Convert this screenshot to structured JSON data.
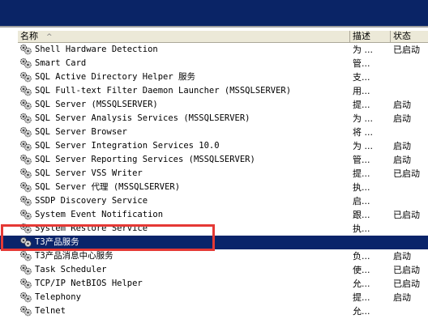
{
  "header": {
    "name": "名称",
    "description": "描述",
    "status": "状态"
  },
  "services": [
    {
      "name": "Shell Hardware Detection",
      "description": "为 ...",
      "status": "已启动"
    },
    {
      "name": "Smart Card",
      "description": "管...",
      "status": ""
    },
    {
      "name": "SQL Active Directory Helper 服务",
      "description": "支...",
      "status": ""
    },
    {
      "name": "SQL Full-text Filter Daemon Launcher (MSSQLSERVER)",
      "description": "用...",
      "status": ""
    },
    {
      "name": "SQL Server (MSSQLSERVER)",
      "description": "提...",
      "status": "启动"
    },
    {
      "name": "SQL Server Analysis Services (MSSQLSERVER)",
      "description": "为 ...",
      "status": "启动"
    },
    {
      "name": "SQL Server Browser",
      "description": "将 ...",
      "status": ""
    },
    {
      "name": "SQL Server Integration Services 10.0",
      "description": "为 ...",
      "status": "启动"
    },
    {
      "name": "SQL Server Reporting Services (MSSQLSERVER)",
      "description": "管...",
      "status": "启动"
    },
    {
      "name": "SQL Server VSS Writer",
      "description": "提...",
      "status": "已启动"
    },
    {
      "name": "SQL Server 代理 (MSSQLSERVER)",
      "description": "执...",
      "status": ""
    },
    {
      "name": "SSDP Discovery Service",
      "description": "启...",
      "status": ""
    },
    {
      "name": "System Event Notification",
      "description": "跟...",
      "status": "已启动"
    },
    {
      "name": "System Restore Service",
      "description": "执...",
      "status": ""
    },
    {
      "name": "T3产品服务",
      "description": "",
      "status": "",
      "selected": true
    },
    {
      "name": "T3产品消息中心服务",
      "description": "负...",
      "status": "启动"
    },
    {
      "name": "Task Scheduler",
      "description": "使...",
      "status": "已启动"
    },
    {
      "name": "TCP/IP NetBIOS Helper",
      "description": "允...",
      "status": "已启动"
    },
    {
      "name": "Telephony",
      "description": "提...",
      "status": "启动"
    },
    {
      "name": "Telnet",
      "description": "允...",
      "status": ""
    }
  ],
  "colors": {
    "selection": "#0a246a",
    "highlight_box": "#e53935",
    "title_bar": "#0a2466"
  }
}
